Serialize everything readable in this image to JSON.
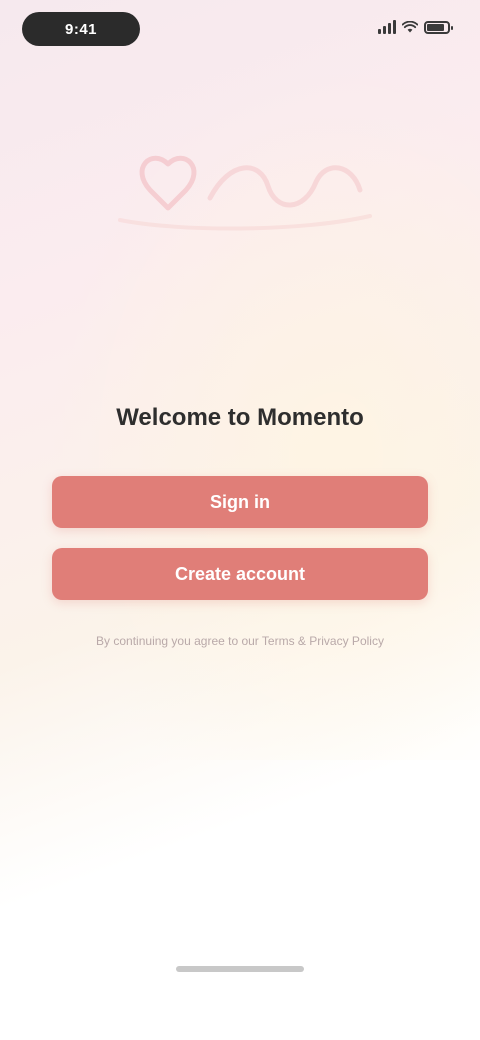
{
  "status_bar": {
    "time": "9:41",
    "signal_level": 4,
    "battery_level": 0.85
  },
  "brand": {
    "name": "",
    "accent_color": "#e07e78",
    "logo_icon": "heart-wordmark-logo"
  },
  "welcome": {
    "title": "Welcome to Momento"
  },
  "actions": {
    "primary_label": "Sign in",
    "secondary_label": "Create account"
  },
  "footer": {
    "terms_text": "By continuing you agree to our Terms & Privacy Policy"
  }
}
